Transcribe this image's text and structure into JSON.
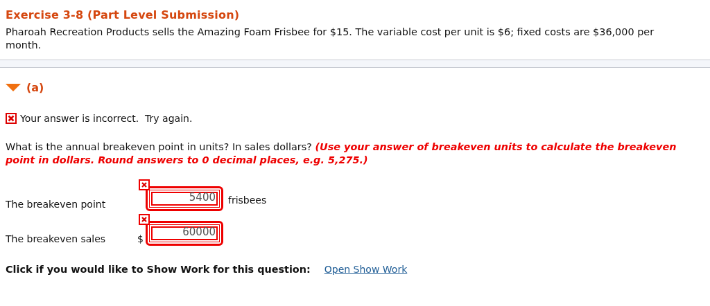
{
  "exercise": {
    "title": "Exercise 3-8 (Part Level Submission)",
    "description": "Pharoah Recreation Products sells the Amazing Foam Frisbee for $15. The variable cost per unit is $6; fixed costs are $36,000 per month."
  },
  "part": {
    "label": "(a)",
    "expanded": true,
    "feedback": {
      "incorrect": true,
      "message": "Your answer is incorrect.  Try again."
    },
    "question": "What is the annual breakeven point in units? In sales dollars? **(Use your answer of breakeven units to calculate the breakeven point in dollars. Round answers to 0 decimal places, e.g. 5,275.)**",
    "answers": [
      {
        "label": "The breakeven point",
        "value": "5400",
        "unit": "frisbees",
        "incorrect": true
      },
      {
        "label": "The breakeven sales",
        "prefix": "$",
        "value": "60000",
        "incorrect": true
      }
    ],
    "show_work": {
      "prompt": "Click if you would like to Show Work for this question:",
      "link": "Open Show Work"
    }
  }
}
